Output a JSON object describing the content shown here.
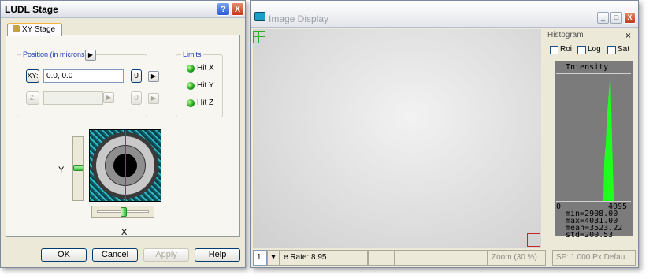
{
  "ludl": {
    "title": "LUDL Stage",
    "help_button": "?",
    "close_button": "X",
    "tab_label": "XY Stage",
    "position_group": "Position (in microns)",
    "limits_group": "Limits",
    "xy_button": "XY:",
    "xy_value": "0.0, 0.0",
    "z_button": "Z:",
    "z_value": "",
    "zero_label": "0",
    "arrow": "▶",
    "limits": [
      "Hit X",
      "Hit Y",
      "Hit Z"
    ],
    "y_axis": "Y",
    "x_axis": "X",
    "buttons": {
      "ok": "OK",
      "cancel": "Cancel",
      "apply": "Apply",
      "help": "Help"
    }
  },
  "image_display": {
    "title": "Image Display",
    "minimize": "_",
    "maximize": "□",
    "close": "X",
    "histogram": {
      "title": "Histogram",
      "close": "×",
      "options": [
        "Roi",
        "Log",
        "Sat"
      ],
      "plot_title": "Intensity",
      "axis_min": "0",
      "axis_max": "4095",
      "stats": [
        "min=2908.00",
        "max=4031.00",
        "mean=3523.22",
        "std=200.53"
      ]
    },
    "status": {
      "channel": "1",
      "dropdown": "▾",
      "frame_rate": "e Rate: 8.95",
      "zoom": "Zoom (30 %)",
      "sf": "SF: 1.000 Px  Defau"
    }
  }
}
